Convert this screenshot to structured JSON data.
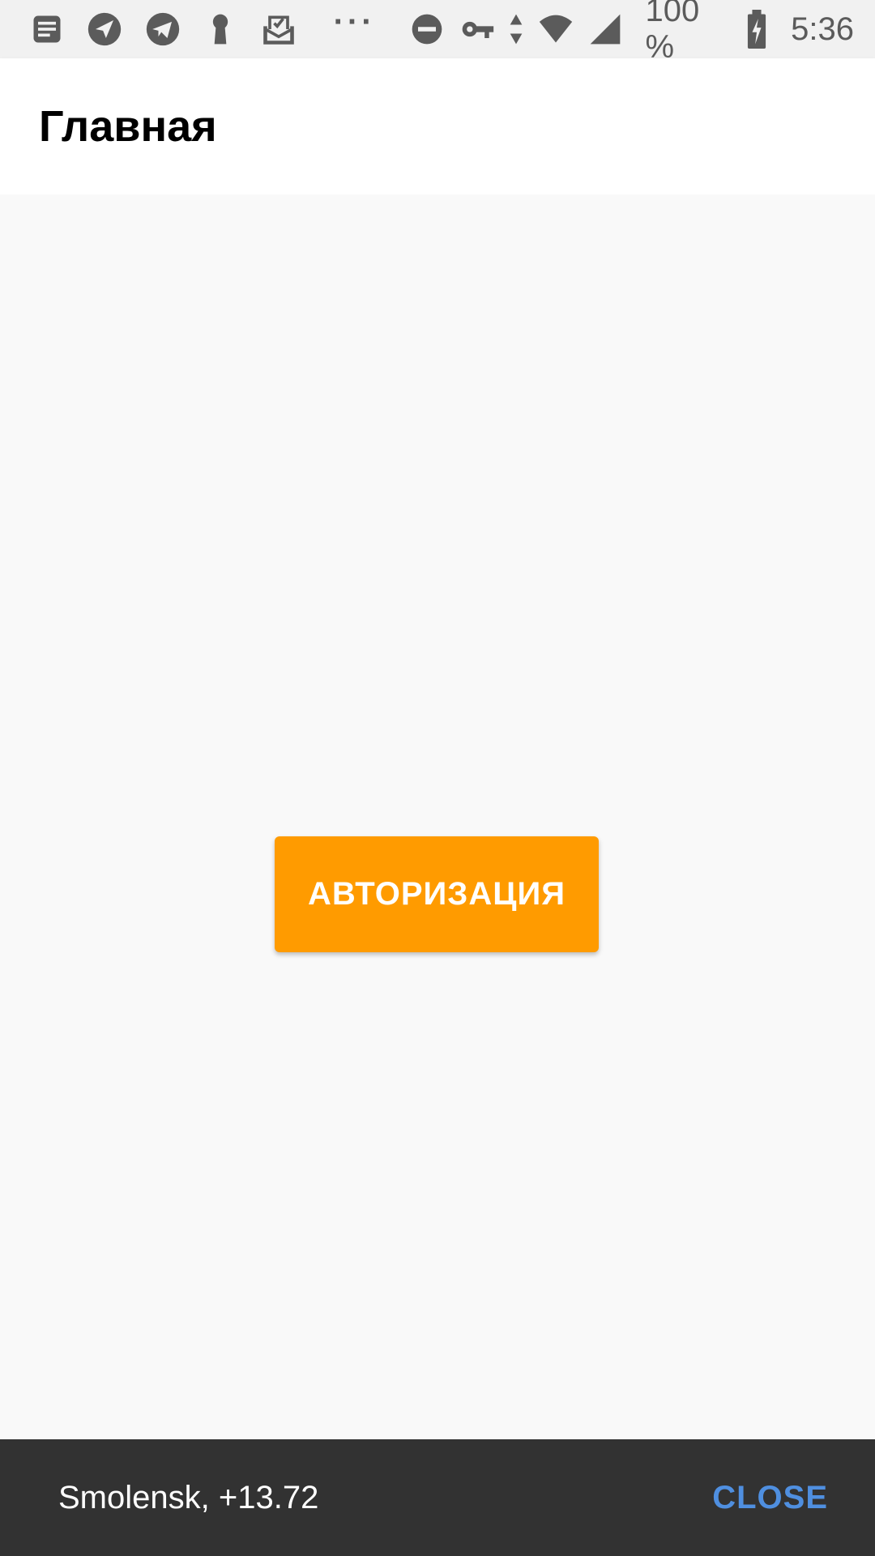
{
  "status_bar": {
    "icons_left": [
      "notes-icon",
      "location-arrow-icon",
      "telegram-icon",
      "keyhole-icon",
      "mail-check-icon"
    ],
    "overflow": "···",
    "icons_right": [
      "do-not-disturb-icon",
      "vpn-key-icon",
      "data-arrows-icon",
      "wifi-icon",
      "cell-signal-icon",
      "battery-charging-icon"
    ],
    "battery": "100 %",
    "time": "5:36"
  },
  "app_bar": {
    "title": "Главная"
  },
  "main": {
    "auth_button_label": "АВТОРИЗАЦИЯ"
  },
  "snackbar": {
    "message": "Smolensk, +13.72",
    "action_label": "CLOSE"
  },
  "colors": {
    "accent": "#ff9b00",
    "snackbar_bg": "#323232",
    "snackbar_action": "#4f8fe0"
  }
}
